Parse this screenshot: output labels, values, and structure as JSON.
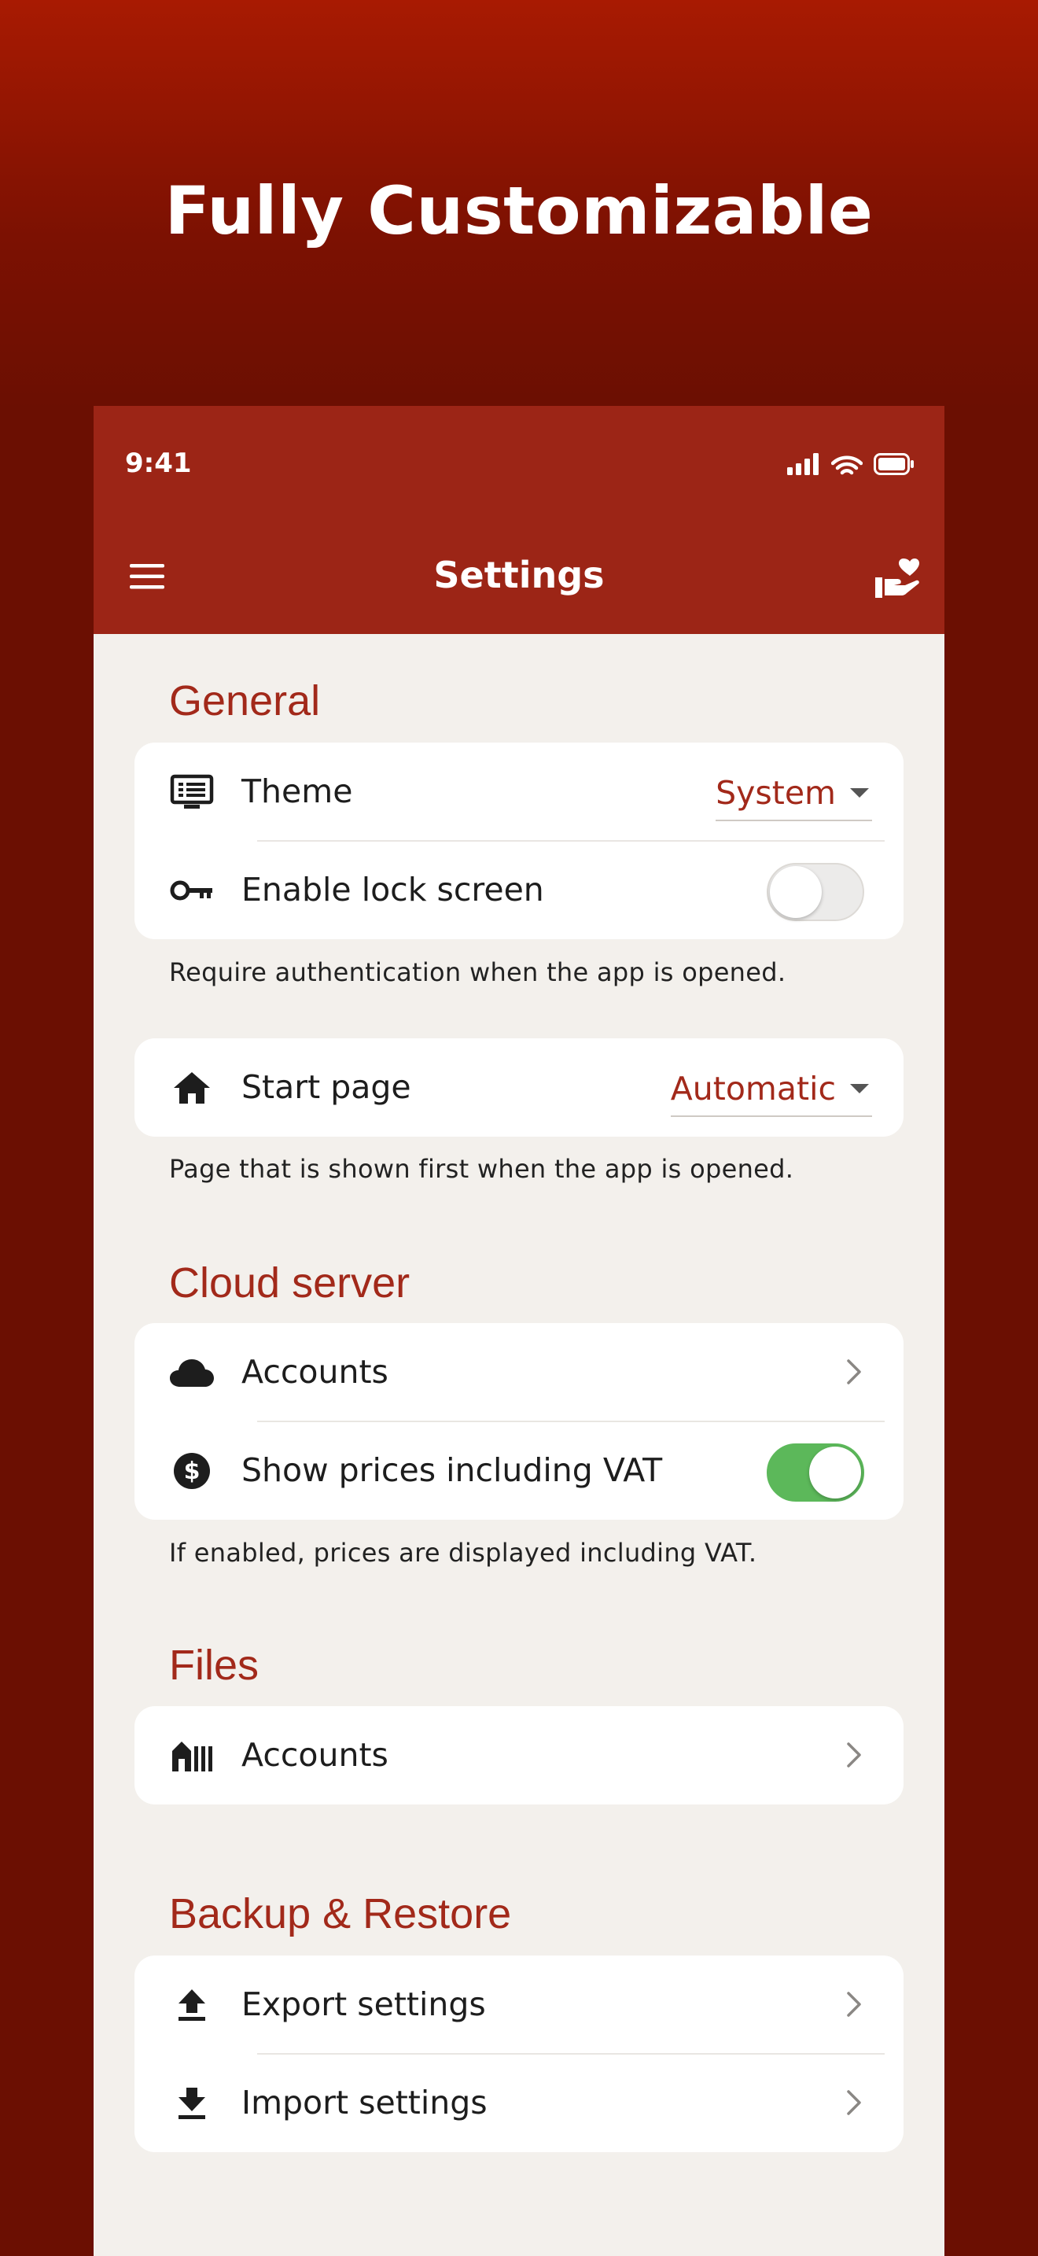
{
  "headline": "Fully Customizable",
  "status_bar": {
    "time": "9:41",
    "icons": [
      "signal-icon",
      "wifi-icon",
      "battery-icon"
    ]
  },
  "app_bar": {
    "title": "Settings",
    "left_icon": "menu-icon",
    "right_icon": "donate-heart-hand-icon"
  },
  "colors": {
    "accent": "#a2291a",
    "app_bar": "#9c2516",
    "background_top": "#a81a02",
    "background_bottom": "#6b0f02",
    "toggle_on": "#5cb85a"
  },
  "general": {
    "title": "General",
    "theme": {
      "label": "Theme",
      "value": "System",
      "icon": "monitor-list-icon"
    },
    "lock_screen": {
      "label": "Enable lock screen",
      "enabled": false,
      "icon": "key-icon"
    },
    "lock_help": "Require authentication when the app is opened.",
    "start_page": {
      "label": "Start page",
      "value": "Automatic",
      "icon": "home-icon"
    },
    "start_help": "Page that is shown first when the app is opened."
  },
  "cloud_server": {
    "title": "Cloud server",
    "accounts": {
      "label": "Accounts",
      "icon": "cloud-icon"
    },
    "vat": {
      "label": "Show prices including VAT",
      "enabled": true,
      "icon": "dollar-circle-icon"
    },
    "vat_help": "If enabled, prices are displayed including VAT."
  },
  "files": {
    "title": "Files",
    "accounts": {
      "label": "Accounts",
      "icon": "storage-icon"
    }
  },
  "backup": {
    "title": "Backup & Restore",
    "export": {
      "label": "Export settings",
      "icon": "upload-icon"
    },
    "import": {
      "label": "Import settings",
      "icon": "download-icon"
    }
  }
}
